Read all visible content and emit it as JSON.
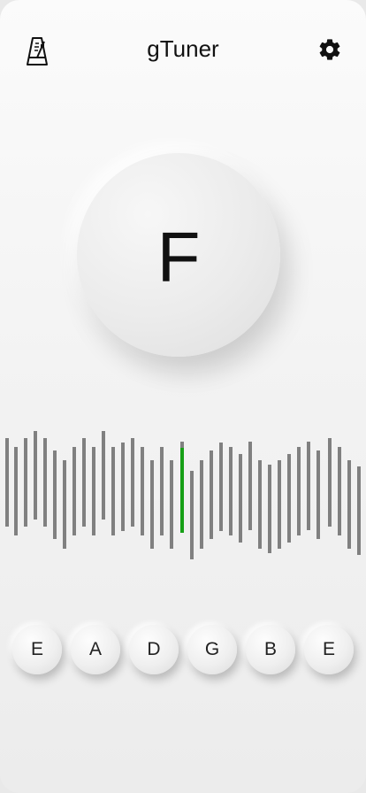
{
  "header": {
    "title": "gTuner",
    "left_icon": "metronome-icon",
    "right_icon": "gear-icon"
  },
  "tuner": {
    "note": "F",
    "in_tune_color": "#16a016",
    "tick_color": "#808080"
  },
  "strings": [
    {
      "label": "E"
    },
    {
      "label": "A"
    },
    {
      "label": "D"
    },
    {
      "label": "G"
    },
    {
      "label": "B"
    },
    {
      "label": "E"
    }
  ]
}
